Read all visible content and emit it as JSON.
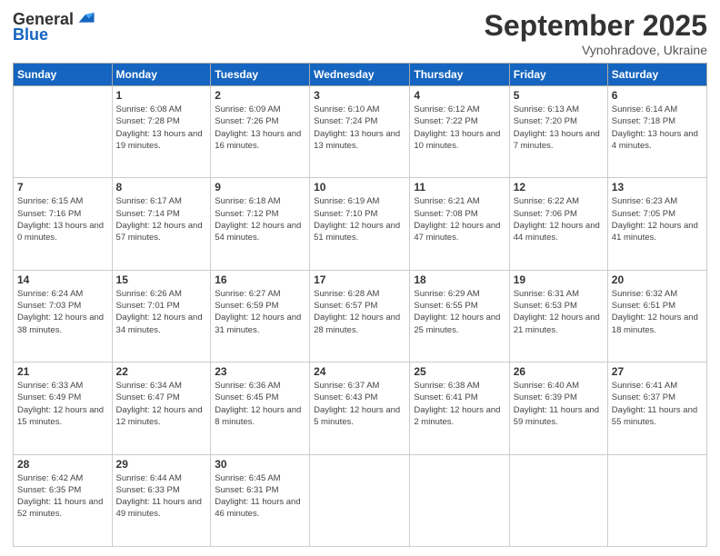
{
  "logo": {
    "general": "General",
    "blue": "Blue"
  },
  "header": {
    "month": "September 2025",
    "location": "Vynohradove, Ukraine"
  },
  "weekdays": [
    "Sunday",
    "Monday",
    "Tuesday",
    "Wednesday",
    "Thursday",
    "Friday",
    "Saturday"
  ],
  "weeks": [
    [
      {
        "day": "",
        "sunrise": "",
        "sunset": "",
        "daylight": ""
      },
      {
        "day": "1",
        "sunrise": "Sunrise: 6:08 AM",
        "sunset": "Sunset: 7:28 PM",
        "daylight": "Daylight: 13 hours and 19 minutes."
      },
      {
        "day": "2",
        "sunrise": "Sunrise: 6:09 AM",
        "sunset": "Sunset: 7:26 PM",
        "daylight": "Daylight: 13 hours and 16 minutes."
      },
      {
        "day": "3",
        "sunrise": "Sunrise: 6:10 AM",
        "sunset": "Sunset: 7:24 PM",
        "daylight": "Daylight: 13 hours and 13 minutes."
      },
      {
        "day": "4",
        "sunrise": "Sunrise: 6:12 AM",
        "sunset": "Sunset: 7:22 PM",
        "daylight": "Daylight: 13 hours and 10 minutes."
      },
      {
        "day": "5",
        "sunrise": "Sunrise: 6:13 AM",
        "sunset": "Sunset: 7:20 PM",
        "daylight": "Daylight: 13 hours and 7 minutes."
      },
      {
        "day": "6",
        "sunrise": "Sunrise: 6:14 AM",
        "sunset": "Sunset: 7:18 PM",
        "daylight": "Daylight: 13 hours and 4 minutes."
      }
    ],
    [
      {
        "day": "7",
        "sunrise": "Sunrise: 6:15 AM",
        "sunset": "Sunset: 7:16 PM",
        "daylight": "Daylight: 13 hours and 0 minutes."
      },
      {
        "day": "8",
        "sunrise": "Sunrise: 6:17 AM",
        "sunset": "Sunset: 7:14 PM",
        "daylight": "Daylight: 12 hours and 57 minutes."
      },
      {
        "day": "9",
        "sunrise": "Sunrise: 6:18 AM",
        "sunset": "Sunset: 7:12 PM",
        "daylight": "Daylight: 12 hours and 54 minutes."
      },
      {
        "day": "10",
        "sunrise": "Sunrise: 6:19 AM",
        "sunset": "Sunset: 7:10 PM",
        "daylight": "Daylight: 12 hours and 51 minutes."
      },
      {
        "day": "11",
        "sunrise": "Sunrise: 6:21 AM",
        "sunset": "Sunset: 7:08 PM",
        "daylight": "Daylight: 12 hours and 47 minutes."
      },
      {
        "day": "12",
        "sunrise": "Sunrise: 6:22 AM",
        "sunset": "Sunset: 7:06 PM",
        "daylight": "Daylight: 12 hours and 44 minutes."
      },
      {
        "day": "13",
        "sunrise": "Sunrise: 6:23 AM",
        "sunset": "Sunset: 7:05 PM",
        "daylight": "Daylight: 12 hours and 41 minutes."
      }
    ],
    [
      {
        "day": "14",
        "sunrise": "Sunrise: 6:24 AM",
        "sunset": "Sunset: 7:03 PM",
        "daylight": "Daylight: 12 hours and 38 minutes."
      },
      {
        "day": "15",
        "sunrise": "Sunrise: 6:26 AM",
        "sunset": "Sunset: 7:01 PM",
        "daylight": "Daylight: 12 hours and 34 minutes."
      },
      {
        "day": "16",
        "sunrise": "Sunrise: 6:27 AM",
        "sunset": "Sunset: 6:59 PM",
        "daylight": "Daylight: 12 hours and 31 minutes."
      },
      {
        "day": "17",
        "sunrise": "Sunrise: 6:28 AM",
        "sunset": "Sunset: 6:57 PM",
        "daylight": "Daylight: 12 hours and 28 minutes."
      },
      {
        "day": "18",
        "sunrise": "Sunrise: 6:29 AM",
        "sunset": "Sunset: 6:55 PM",
        "daylight": "Daylight: 12 hours and 25 minutes."
      },
      {
        "day": "19",
        "sunrise": "Sunrise: 6:31 AM",
        "sunset": "Sunset: 6:53 PM",
        "daylight": "Daylight: 12 hours and 21 minutes."
      },
      {
        "day": "20",
        "sunrise": "Sunrise: 6:32 AM",
        "sunset": "Sunset: 6:51 PM",
        "daylight": "Daylight: 12 hours and 18 minutes."
      }
    ],
    [
      {
        "day": "21",
        "sunrise": "Sunrise: 6:33 AM",
        "sunset": "Sunset: 6:49 PM",
        "daylight": "Daylight: 12 hours and 15 minutes."
      },
      {
        "day": "22",
        "sunrise": "Sunrise: 6:34 AM",
        "sunset": "Sunset: 6:47 PM",
        "daylight": "Daylight: 12 hours and 12 minutes."
      },
      {
        "day": "23",
        "sunrise": "Sunrise: 6:36 AM",
        "sunset": "Sunset: 6:45 PM",
        "daylight": "Daylight: 12 hours and 8 minutes."
      },
      {
        "day": "24",
        "sunrise": "Sunrise: 6:37 AM",
        "sunset": "Sunset: 6:43 PM",
        "daylight": "Daylight: 12 hours and 5 minutes."
      },
      {
        "day": "25",
        "sunrise": "Sunrise: 6:38 AM",
        "sunset": "Sunset: 6:41 PM",
        "daylight": "Daylight: 12 hours and 2 minutes."
      },
      {
        "day": "26",
        "sunrise": "Sunrise: 6:40 AM",
        "sunset": "Sunset: 6:39 PM",
        "daylight": "Daylight: 11 hours and 59 minutes."
      },
      {
        "day": "27",
        "sunrise": "Sunrise: 6:41 AM",
        "sunset": "Sunset: 6:37 PM",
        "daylight": "Daylight: 11 hours and 55 minutes."
      }
    ],
    [
      {
        "day": "28",
        "sunrise": "Sunrise: 6:42 AM",
        "sunset": "Sunset: 6:35 PM",
        "daylight": "Daylight: 11 hours and 52 minutes."
      },
      {
        "day": "29",
        "sunrise": "Sunrise: 6:44 AM",
        "sunset": "Sunset: 6:33 PM",
        "daylight": "Daylight: 11 hours and 49 minutes."
      },
      {
        "day": "30",
        "sunrise": "Sunrise: 6:45 AM",
        "sunset": "Sunset: 6:31 PM",
        "daylight": "Daylight: 11 hours and 46 minutes."
      },
      {
        "day": "",
        "sunrise": "",
        "sunset": "",
        "daylight": ""
      },
      {
        "day": "",
        "sunrise": "",
        "sunset": "",
        "daylight": ""
      },
      {
        "day": "",
        "sunrise": "",
        "sunset": "",
        "daylight": ""
      },
      {
        "day": "",
        "sunrise": "",
        "sunset": "",
        "daylight": ""
      }
    ]
  ]
}
